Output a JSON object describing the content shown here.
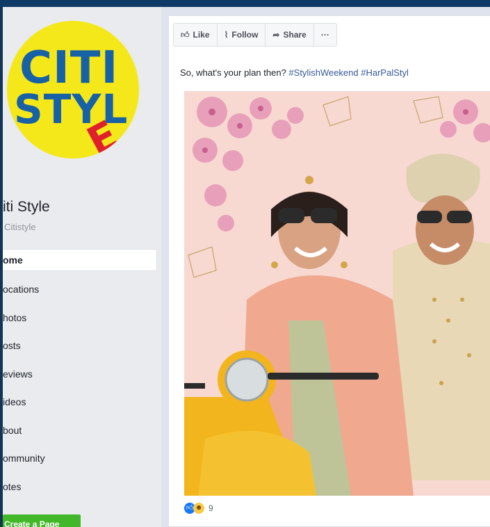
{
  "sidebar": {
    "logo_text": {
      "line1": "CITI",
      "line2": "STYL",
      "accent": "E"
    },
    "page_name": "iti Style",
    "handle": "Citistyle",
    "nav": [
      "ome",
      "ocations",
      "hotos",
      "osts",
      "eviews",
      "ideos",
      "bout",
      "ommunity",
      "otes"
    ],
    "create_button": "Create a Page"
  },
  "post": {
    "actions": {
      "like": "Like",
      "follow": "Follow",
      "share": "Share",
      "more": "···"
    },
    "caption_text": "So, what's your plan then? ",
    "hashtags": "#StylishWeekend #HarPalStyl",
    "reactions_count": "9"
  },
  "colors": {
    "logo_yellow": "#f4e81a",
    "logo_blue": "#1761a6",
    "logo_red": "#e0202a",
    "link": "#365899",
    "create_green": "#42b72a"
  }
}
